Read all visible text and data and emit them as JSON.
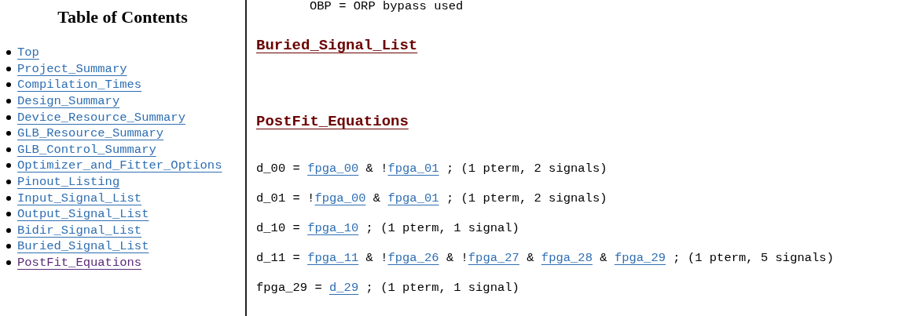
{
  "toc": {
    "title": "Table of Contents",
    "items": [
      {
        "label": "Top",
        "visited": false
      },
      {
        "label": "Project_Summary",
        "visited": false
      },
      {
        "label": "Compilation_Times",
        "visited": false
      },
      {
        "label": "Design_Summary",
        "visited": false
      },
      {
        "label": "Device_Resource_Summary",
        "visited": false
      },
      {
        "label": "GLB_Resource_Summary",
        "visited": false
      },
      {
        "label": "GLB_Control_Summary",
        "visited": false
      },
      {
        "label": "Optimizer_and_Fitter_Options",
        "visited": false
      },
      {
        "label": "Pinout_Listing",
        "visited": false
      },
      {
        "label": "Input_Signal_List",
        "visited": false
      },
      {
        "label": "Output_Signal_List",
        "visited": false
      },
      {
        "label": "Bidir_Signal_List",
        "visited": false
      },
      {
        "label": "Buried_Signal_List",
        "visited": false
      },
      {
        "label": "PostFit_Equations",
        "visited": true
      }
    ]
  },
  "report": {
    "note": "OBP = ORP bypass used",
    "sections": [
      {
        "heading": "Buried_Signal_List"
      },
      {
        "heading": "PostFit_Equations",
        "equations": [
          {
            "parts": [
              {
                "kind": "text",
                "text": "d_00 = "
              },
              {
                "kind": "link",
                "text": "fpga_00"
              },
              {
                "kind": "text",
                "text": " & !"
              },
              {
                "kind": "link",
                "text": "fpga_01"
              },
              {
                "kind": "text",
                "text": " ; (1 pterm, 2 signals)"
              }
            ]
          },
          {
            "parts": [
              {
                "kind": "text",
                "text": "d_01 = !"
              },
              {
                "kind": "link",
                "text": "fpga_00"
              },
              {
                "kind": "text",
                "text": " & "
              },
              {
                "kind": "link",
                "text": "fpga_01"
              },
              {
                "kind": "text",
                "text": " ; (1 pterm, 2 signals)"
              }
            ]
          },
          {
            "parts": [
              {
                "kind": "text",
                "text": "d_10 = "
              },
              {
                "kind": "link",
                "text": "fpga_10"
              },
              {
                "kind": "text",
                "text": " ; (1 pterm, 1 signal)"
              }
            ]
          },
          {
            "parts": [
              {
                "kind": "text",
                "text": "d_11 = "
              },
              {
                "kind": "link",
                "text": "fpga_11"
              },
              {
                "kind": "text",
                "text": " & !"
              },
              {
                "kind": "link",
                "text": "fpga_26"
              },
              {
                "kind": "text",
                "text": " & !"
              },
              {
                "kind": "link",
                "text": "fpga_27"
              },
              {
                "kind": "text",
                "text": " & "
              },
              {
                "kind": "link",
                "text": "fpga_28"
              },
              {
                "kind": "text",
                "text": " & "
              },
              {
                "kind": "link",
                "text": "fpga_29"
              },
              {
                "kind": "text",
                "text": " ; (1 pterm, 5 signals)"
              }
            ]
          },
          {
            "parts": [
              {
                "kind": "text",
                "text": "fpga_29 = "
              },
              {
                "kind": "link",
                "text": "d_29"
              },
              {
                "kind": "text",
                "text": " ; (1 pterm, 1 signal)"
              }
            ]
          }
        ]
      }
    ]
  }
}
